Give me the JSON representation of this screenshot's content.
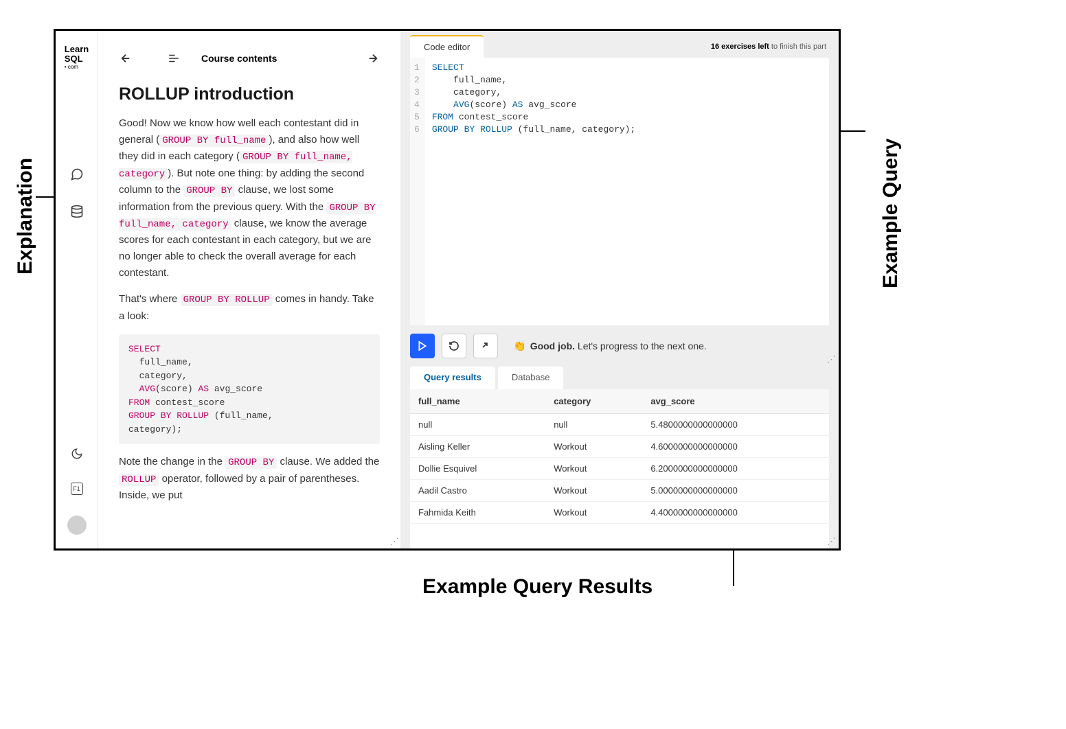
{
  "labels": {
    "explanation": "Explanation",
    "example_query": "Example Query",
    "example_results": "Example Query Results"
  },
  "logo": {
    "line1": "Learn",
    "line2": "SQL",
    "sub": "• com"
  },
  "header": {
    "course_contents": "Course contents"
  },
  "page": {
    "title": "ROLLUP introduction",
    "p1a": "Good! Now we know how well each contestant did in general",
    "chip1": "GROUP BY full_name",
    "p1b": "), and also how well they did in each category",
    "chip2": "GROUP BY full_name, category",
    "p1c": "). But note one thing: by adding the second column to the ",
    "chip3": "GROUP BY",
    "p1d": " clause, we lost some information from the previous query. With the ",
    "chip4": "GROUP BY full_name, category",
    "p1e": " clause, we know the average scores for each contestant in each category, but we are no longer able to check the overall average for each contestant.",
    "p2a": "That's where ",
    "chip5": "GROUP BY ROLLUP",
    "p2b": " comes in handy. Take a look:",
    "code_block": "SELECT\n  full_name,\n  category,\n  AVG(score) AS avg_score\nFROM contest_score\nGROUP BY ROLLUP (full_name,\ncategory);",
    "p3a": "Note the change in the ",
    "chip6": "GROUP BY",
    "p3b": " clause. We added the ",
    "chip7": "ROLLUP",
    "p3c": " operator, followed by a pair of parentheses. Inside, we put"
  },
  "editor": {
    "tab": "Code editor",
    "exercises_bold": "16 exercises left",
    "exercises_rest": " to finish this part",
    "lines": [
      "1",
      "2",
      "3",
      "4",
      "5",
      "6"
    ],
    "code": "SELECT\n    full_name,\n    category,\n    AVG(score) AS avg_score\nFROM contest_score\nGROUP BY ROLLUP (full_name, category);"
  },
  "controls": {
    "status_emoji": "👏",
    "status_bold": "Good job.",
    "status_rest": " Let's progress to the next one."
  },
  "results": {
    "tab_results": "Query results",
    "tab_database": "Database",
    "columns": [
      "full_name",
      "category",
      "avg_score"
    ],
    "rows": [
      [
        "null",
        "null",
        "5.4800000000000000"
      ],
      [
        "Aisling Keller",
        "Workout",
        "4.6000000000000000"
      ],
      [
        "Dollie Esquivel",
        "Workout",
        "6.2000000000000000"
      ],
      [
        "Aadil Castro",
        "Workout",
        "5.0000000000000000"
      ],
      [
        "Fahmida Keith",
        "Workout",
        "4.4000000000000000"
      ]
    ]
  }
}
